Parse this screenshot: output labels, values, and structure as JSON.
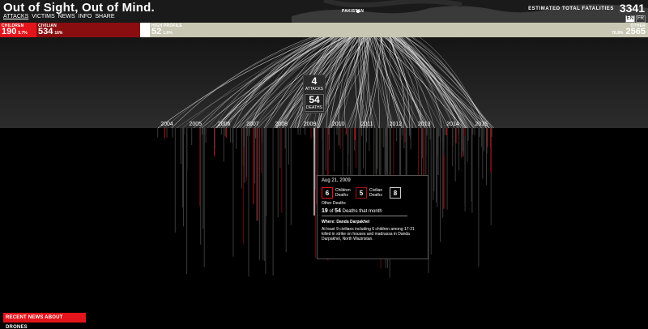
{
  "header": {
    "title": "Out of Sight, Out of Mind.",
    "nav": [
      "ATTACKS",
      "VICTIMS",
      "NEWS",
      "INFO",
      "SHARE"
    ],
    "country": "PAKISTAN",
    "total_label": "ESTIMATED TOTAL FATALITIES",
    "total_value": "3341",
    "languages": [
      "EN",
      "FR"
    ]
  },
  "categories": {
    "children": {
      "label": "CHILDREN",
      "value": "190",
      "pct": "5.7%"
    },
    "civilian": {
      "label": "CIVILIAN",
      "value": "534",
      "pct": "16%"
    },
    "high_profile": {
      "label": "HIGH PROFILE",
      "value": "52",
      "pct": "1.6%"
    },
    "other": {
      "label": "OTHER",
      "value": "2565",
      "pct": "76.8%"
    }
  },
  "timeline": {
    "years": [
      "2004",
      "2005",
      "2006",
      "2007",
      "2008",
      "2009",
      "2010",
      "2011",
      "2012",
      "2013",
      "2014",
      "2015"
    ]
  },
  "selected_month": {
    "attacks": "4",
    "attacks_label": "ATTACKS",
    "deaths": "54",
    "deaths_label": "DEATHS"
  },
  "tooltip": {
    "date": "Aug 21, 2009",
    "children": "6",
    "children_label": "Children Deaths",
    "civilian": "5",
    "civilian_label": "Civilian Deaths",
    "other": "8",
    "other_label": "Other Deaths",
    "month_count": "19",
    "month_of": "of",
    "month_total": "54",
    "month_suffix": "Deaths that month",
    "where": "Where: Danda Darpakhel",
    "description": "At least 9 civilians including 6 children among 17-21 killed in strike on houses and madrassa in Danda Darpakhel, North Waziristan."
  },
  "news_button": "RECENT NEWS ABOUT DRONES",
  "colors": {
    "children": "#e3141b",
    "civilian": "#8a0e10",
    "high_profile": "#ffffff",
    "other": "#c8c7b3"
  }
}
